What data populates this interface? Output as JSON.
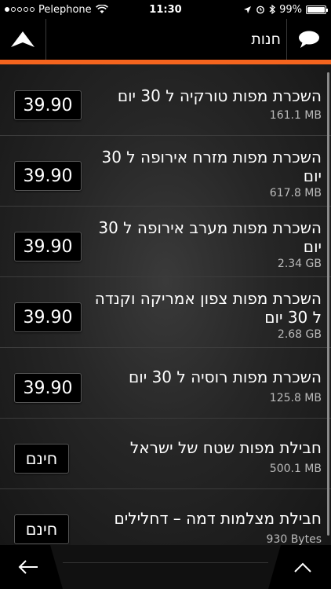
{
  "status_bar": {
    "carrier": "Pelephone",
    "time": "11:30",
    "battery": "99%"
  },
  "nav": {
    "title": "חנות",
    "up_icon": "arrow-up-icon",
    "chat_icon": "speech-bubble-icon"
  },
  "items": [
    {
      "title": "השכרת מפות טורקיה ל 30 יום",
      "size": "161.1 MB",
      "price": "39.90"
    },
    {
      "title": "השכרת מפות מזרח אירופה ל 30 יום",
      "size": "617.8 MB",
      "price": "39.90"
    },
    {
      "title": "השכרת מפות מערב אירופה ל 30 יום",
      "size": "2.34 GB",
      "price": "39.90"
    },
    {
      "title": "השכרת מפות צפון אמריקה וקנדה ל 30 יום",
      "size": "2.68 GB",
      "price": "39.90"
    },
    {
      "title": "השכרת מפות רוסיה ל 30 יום",
      "size": "125.8 MB",
      "price": "39.90"
    },
    {
      "title": "חבילת מפות שטח של ישראל",
      "size": "500.1 MB",
      "price": "חינם"
    },
    {
      "title": "חבילת מצלמות דמה – דחלילים",
      "size": "930 Bytes",
      "price": "חינם"
    }
  ],
  "bottom": {
    "back_icon": "back-arrow-icon",
    "up_icon": "chevron-up-icon"
  },
  "colors": {
    "accent": "#f4641e"
  }
}
